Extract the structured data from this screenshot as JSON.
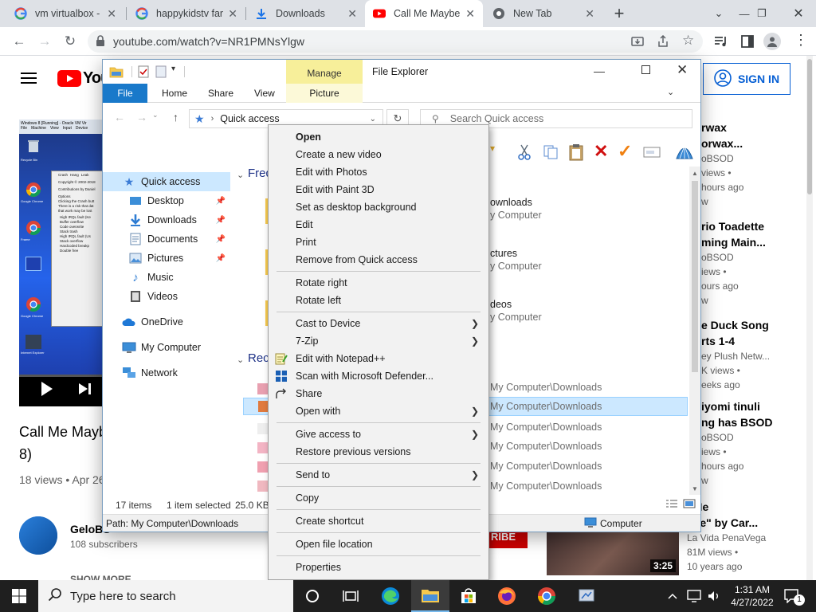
{
  "browser": {
    "tabs": [
      {
        "label": "vm virtualbox - ",
        "icon": "google-icon"
      },
      {
        "label": "happykidstv fan",
        "icon": "google-icon"
      },
      {
        "label": "Downloads",
        "icon": "download-icon"
      },
      {
        "label": "Call Me Maybe",
        "icon": "youtube-icon"
      },
      {
        "label": "New Tab",
        "icon": "chrome-icon"
      }
    ],
    "url": "youtube.com/watch?v=NR1PMNsYlgw"
  },
  "youtube": {
    "logo_text": "You",
    "sign_in": "SIGN IN",
    "video_title_1": "Call Me Mayb",
    "video_title_2": "8)",
    "video_meta": "18 views • Apr 26",
    "channel_name": "GeloBS",
    "subscribers": "108 subscribers",
    "subscribe_partial": "RIBE",
    "show_more": "SHOW MORE",
    "vm_titlebar": "Windows 8 [Running] - Oracle VM Vir",
    "vm_menu": [
      "File",
      "Machine",
      "View",
      "Input",
      "Device"
    ],
    "vm_tabs": [
      "Crash",
      "Hang",
      "Leak"
    ],
    "vm_text": [
      "Copyright © 2002-2018",
      "Contributions by Daniel",
      "Options",
      "Clicking the Crash butt",
      "There is a risk that dat",
      "that work may be lost"
    ],
    "vm_options": [
      "High IRQL fault (Ke",
      "Buffer overflow",
      "Code overwrite",
      "Stack trash",
      "High IRQL fault (Us",
      "Stack overflow",
      "Hardcoded breakp",
      "Double free"
    ],
    "vm_desktop_icons": [
      "Recycle Bin",
      "Google Chrome",
      "Frame",
      "Google Chrome",
      "Internet Explorer"
    ],
    "sidebar": [
      {
        "line1": "rwax",
        "line2": "orwax...",
        "line3": "oBSOD",
        "line4": "views •",
        "line5": "hours ago",
        "line6": "w"
      },
      {
        "line1": "rio Toadette",
        "line2": "ming Main...",
        "line3": "oBSOD",
        "line4": "iews •",
        "line5": "ours ago",
        "line6": "w"
      },
      {
        "line1": "e Duck Song",
        "line2": "rts 1-4",
        "line3": "ey Plush Netw...",
        "line4": "K views •",
        "line5": "eeks ago",
        "line6": ""
      },
      {
        "line1": "iyomi tinuli",
        "line2": "ng has BSOD",
        "line3": "oBSOD",
        "line4": "iews •",
        "line5": "hours ago",
        "line6": "w"
      },
      {
        "line1": "l Me",
        "line2": "ybe\" by Car...",
        "line3": "La Vida PenaVega",
        "line4": "81M views •",
        "line5": "10 years ago",
        "line6": ""
      }
    ],
    "thumb_duration": "3:25"
  },
  "explorer": {
    "title": "File Explorer",
    "manage": "Manage",
    "ribbon_tabs": [
      "File",
      "Home",
      "Share",
      "View",
      "Picture Tools"
    ],
    "address": "Quick access",
    "search_placeholder": "Search Quick access",
    "nav_items": [
      {
        "label": "Quick access",
        "icon": "star-icon"
      },
      {
        "label": "Desktop",
        "icon": "desktop-icon"
      },
      {
        "label": "Downloads",
        "icon": "download-icon"
      },
      {
        "label": "Documents",
        "icon": "documents-icon"
      },
      {
        "label": "Pictures",
        "icon": "pictures-icon"
      },
      {
        "label": "Music",
        "icon": "music-icon"
      },
      {
        "label": "Videos",
        "icon": "videos-icon"
      },
      {
        "label": "OneDrive",
        "icon": "cloud-icon"
      },
      {
        "label": "My Computer",
        "icon": "computer-icon"
      },
      {
        "label": "Network",
        "icon": "network-icon"
      }
    ],
    "section_frequent": "Fred",
    "section_recent": "Rec",
    "frequent": [
      {
        "name": "ownloads",
        "loc": "y Computer"
      },
      {
        "name": "ctures",
        "loc": "y Computer"
      },
      {
        "name": "deos",
        "loc": "y Computer"
      }
    ],
    "recent_locations": [
      "My Computer\\Downloads",
      "My Computer\\Downloads",
      "My Computer\\Downloads",
      "My Computer\\Downloads",
      "My Computer\\Downloads",
      "My Computer\\Downloads"
    ],
    "status_items": "17 items",
    "status_selected": "1 item selected",
    "status_size": "25.0 KB",
    "path": "Path: My Computer\\Downloads",
    "path_right": "Computer"
  },
  "context_menu": [
    {
      "label": "Open",
      "bold": true
    },
    {
      "label": "Create a new video"
    },
    {
      "label": "Edit with Photos"
    },
    {
      "label": "Edit with Paint 3D"
    },
    {
      "label": "Set as desktop background"
    },
    {
      "label": "Edit"
    },
    {
      "label": "Print"
    },
    {
      "label": "Remove from Quick access"
    },
    {
      "label": "Rotate right"
    },
    {
      "label": "Rotate left"
    },
    {
      "label": "Cast to Device",
      "sub": true
    },
    {
      "label": "7-Zip",
      "sub": true
    },
    {
      "label": "Edit with Notepad++",
      "icon": "notepad-icon"
    },
    {
      "label": "Scan with Microsoft Defender...",
      "icon": "defender-icon"
    },
    {
      "label": "Share",
      "icon": "share-icon"
    },
    {
      "label": "Open with",
      "sub": true
    },
    {
      "label": "Give access to",
      "sub": true
    },
    {
      "label": "Restore previous versions"
    },
    {
      "label": "Send to",
      "sub": true
    },
    {
      "label": "Copy"
    },
    {
      "label": "Create shortcut"
    },
    {
      "label": "Open file location"
    },
    {
      "label": "Properties"
    }
  ],
  "taskbar": {
    "search_placeholder": "Type here to search",
    "time": "1:31 AM",
    "date": "4/27/2022",
    "notification_count": "1"
  }
}
